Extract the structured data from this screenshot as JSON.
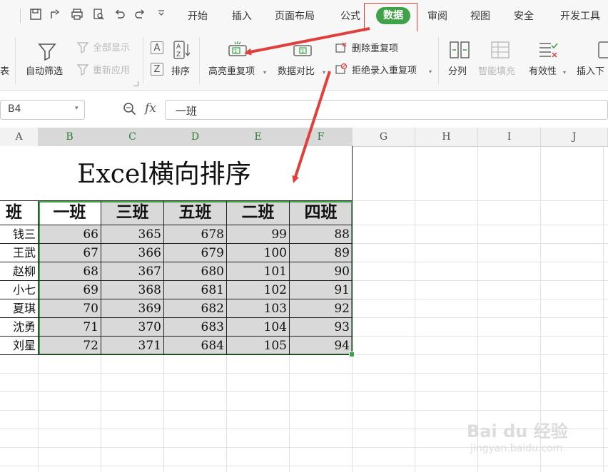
{
  "menubar": {
    "tabs": [
      "开始",
      "插入",
      "页面布局",
      "公式",
      "数据",
      "审阅",
      "视图",
      "安全",
      "开发工具"
    ],
    "active_tab": "数据"
  },
  "ribbon": {
    "left_partial": "表",
    "auto_filter": "自动筛选",
    "show_all": "全部显示",
    "reapply": "重新应用",
    "sort": "排序",
    "highlight_dup": "高亮重复项",
    "compare": "数据对比",
    "remove_dup": "删除重复项",
    "reject_dup": "拒绝录入重复项",
    "split": "分列",
    "smart_fill": "智能填充",
    "validity": "有效性",
    "insert_dropdown": "插入下"
  },
  "formula_bar": {
    "cell_ref": "B4",
    "fx": "fx",
    "value": "一班"
  },
  "columns": [
    "A",
    "B",
    "C",
    "D",
    "E",
    "F",
    "G",
    "H",
    "I",
    "J"
  ],
  "sheet": {
    "title": "Excel横向排序",
    "header_label": "班级",
    "class_headers": [
      "一班",
      "三班",
      "五班",
      "二班",
      "四班"
    ],
    "rows": [
      {
        "name": "钱三",
        "values": [
          66,
          365,
          678,
          99,
          88
        ]
      },
      {
        "name": "王武",
        "values": [
          67,
          366,
          679,
          100,
          89
        ]
      },
      {
        "name": "赵柳",
        "values": [
          68,
          367,
          680,
          101,
          90
        ]
      },
      {
        "name": "小七",
        "values": [
          69,
          368,
          681,
          102,
          91
        ]
      },
      {
        "name": "夏琪",
        "values": [
          70,
          369,
          682,
          103,
          92
        ]
      },
      {
        "name": "沈勇",
        "values": [
          71,
          370,
          683,
          104,
          93
        ]
      },
      {
        "name": "刘星",
        "values": [
          72,
          371,
          684,
          105,
          94
        ]
      }
    ]
  },
  "watermark": {
    "brand": "Bai du 经验",
    "url": "jingyan.baidu.com"
  },
  "colors": {
    "active_tab": "#3fa148",
    "selection_border": "#3fa148",
    "selection_fill": "#d9d9d9",
    "annotation_red": "#e0403c"
  }
}
